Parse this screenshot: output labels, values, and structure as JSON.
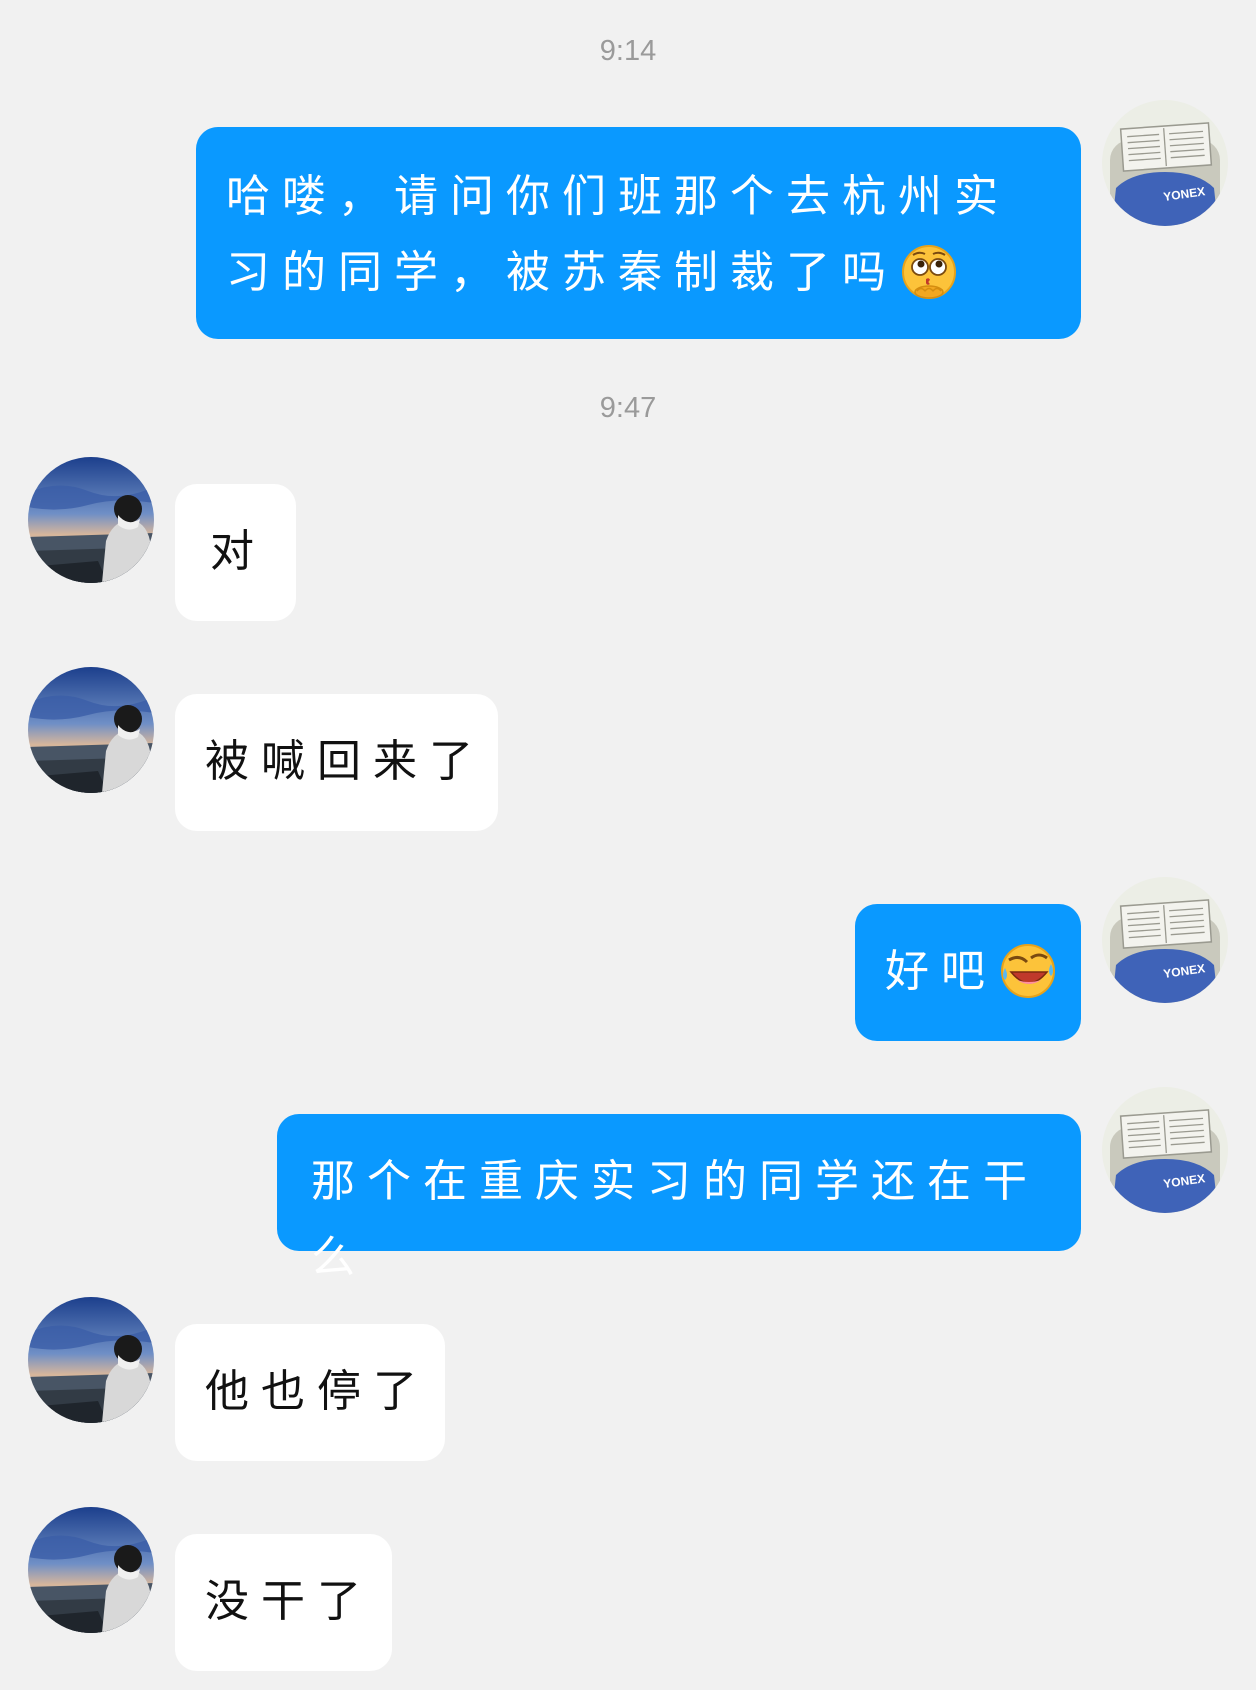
{
  "timestamps": [
    "9:14",
    "9:47"
  ],
  "messages": [
    {
      "sender": "me",
      "text": "哈喽，请问你们班那个去杭州实习的同学，被苏秦制裁了吗",
      "emoji": "thinking-emoji"
    },
    {
      "sender": "other",
      "text": "对"
    },
    {
      "sender": "other",
      "text": "被喊回来了"
    },
    {
      "sender": "me",
      "text": "好吧",
      "emoji": "laugh-cry-emoji"
    },
    {
      "sender": "me",
      "text": "那个在重庆实习的同学还在干么"
    },
    {
      "sender": "other",
      "text": "他也停了"
    },
    {
      "sender": "other",
      "text": "没干了"
    }
  ],
  "avatars": {
    "me": {
      "shirt_text": "YONEX"
    }
  },
  "colors": {
    "background": "#f1f1f1",
    "my_bubble": "#0a99ff",
    "their_bubble": "#ffffff",
    "timestamp": "#9a9a9a"
  }
}
